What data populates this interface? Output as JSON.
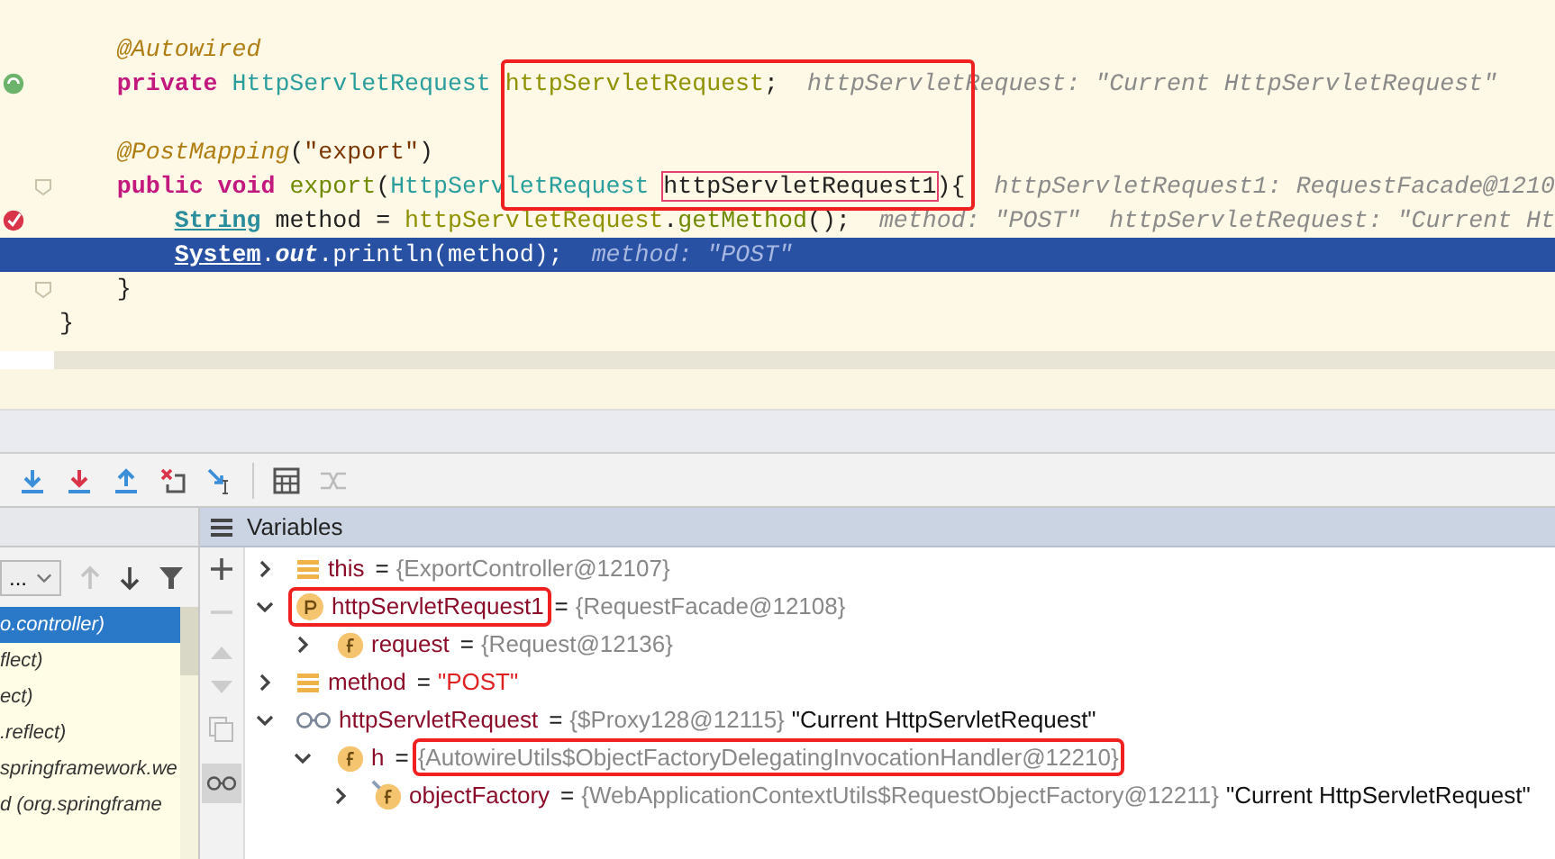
{
  "editor": {
    "lines": [
      {
        "kind": "code",
        "fold": false,
        "highlighted": false,
        "code": [
          {
            "kind": "annotation",
            "text": "    @Autowired"
          }
        ]
      },
      {
        "kind": "code",
        "gutter": {
          "kind": "bean"
        },
        "fold": false,
        "highlighted": false,
        "code": [
          {
            "kind": "keyword",
            "text": "    private "
          },
          {
            "kind": "type",
            "text": "HttpServletRequest "
          },
          {
            "kind": "field",
            "text": "httpServletRequest"
          },
          {
            "kind": "plain",
            "text": ";"
          }
        ],
        "hints": [
          "httpServletRequest: \"Current HttpServletRequest\""
        ]
      },
      {
        "kind": "blank"
      },
      {
        "kind": "code",
        "fold": false,
        "highlighted": false,
        "code": [
          {
            "kind": "annotation",
            "text": "    @PostMapping"
          },
          {
            "kind": "plain",
            "text": "("
          },
          {
            "kind": "string",
            "text": "\"export\""
          },
          {
            "kind": "plain",
            "text": ")"
          }
        ]
      },
      {
        "kind": "code",
        "fold": true,
        "highlighted": false,
        "code": [
          {
            "kind": "keyword",
            "text": "    public void "
          },
          {
            "kind": "method",
            "text": "export"
          },
          {
            "kind": "plain",
            "text": "("
          },
          {
            "kind": "type",
            "text": "HttpServletRequest "
          },
          {
            "kind": "param",
            "text": "httpServletRequest1",
            "boxed": true
          },
          {
            "kind": "plain",
            "text": "){"
          }
        ],
        "hints": [
          "httpServletRequest1: RequestFacade@1210"
        ]
      },
      {
        "kind": "code",
        "gutter": {
          "kind": "breakpoint"
        },
        "fold": false,
        "highlighted": false,
        "code": [
          {
            "kind": "class",
            "text": "        String"
          },
          {
            "kind": "plain",
            "text": " method = "
          },
          {
            "kind": "field",
            "text": "httpServletRequest"
          },
          {
            "kind": "plain",
            "text": "."
          },
          {
            "kind": "method",
            "text": "getMethod"
          },
          {
            "kind": "plain",
            "text": "();"
          }
        ],
        "hints": [
          "method: \"POST\"",
          "httpServletRequest: \"Current Ht"
        ]
      },
      {
        "kind": "code",
        "fold": false,
        "highlighted": true,
        "code": [
          {
            "kind": "class",
            "text": "        System"
          },
          {
            "kind": "plain",
            "text": "."
          },
          {
            "kind": "static",
            "text": "out"
          },
          {
            "kind": "plain",
            "text": ".println(method);"
          }
        ],
        "hints": [
          "method: \"POST\""
        ]
      },
      {
        "kind": "code",
        "fold": true,
        "highlighted": false,
        "code": [
          {
            "kind": "plain",
            "text": "    }"
          }
        ]
      },
      {
        "kind": "code",
        "fold": false,
        "highlighted": false,
        "code": [
          {
            "kind": "plain",
            "text": "}"
          }
        ]
      }
    ]
  },
  "frames": {
    "dropdown": "...",
    "items": [
      {
        "text": "o.controller)",
        "selected": true
      },
      {
        "text": "flect)",
        "selected": false
      },
      {
        "text": "ect)",
        "selected": false
      },
      {
        "text": ".reflect)",
        "selected": false
      },
      {
        "text": "springframework.we",
        "selected": false
      },
      {
        "text": "d (org.springframe",
        "selected": false
      }
    ]
  },
  "variables": {
    "title": "Variables",
    "rows": [
      {
        "kind": "fields",
        "name": "this",
        "operator": "=",
        "value": "{ExportController@12107}",
        "string_value": false,
        "expanded": false,
        "name_boxed": false,
        "value_boxed": false
      },
      {
        "kind": "param",
        "name": "httpServletRequest1",
        "operator": "=",
        "value": "{RequestFacade@12108}",
        "string_value": false,
        "expanded": true,
        "name_boxed": true,
        "value_boxed": false,
        "children": [
          {
            "kind": "field",
            "name": "request",
            "operator": "=",
            "value": "{Request@12136}",
            "string_value": false,
            "expanded": false,
            "name_boxed": false,
            "value_boxed": false
          }
        ]
      },
      {
        "kind": "fields",
        "name": "method",
        "operator": "=",
        "value": "\"POST\"",
        "string_value": true,
        "expanded": false,
        "name_boxed": false,
        "value_boxed": false
      },
      {
        "kind": "watch",
        "name": "httpServletRequest",
        "operator": "=",
        "value": "{$Proxy128@12115}",
        "string_value": false,
        "note": "\"Current HttpServletRequest\"",
        "expanded": true,
        "name_boxed": false,
        "value_boxed": false,
        "children": [
          {
            "kind": "field",
            "name": "h",
            "operator": "=",
            "value": "{AutowireUtils$ObjectFactoryDelegatingInvocationHandler@12210}",
            "string_value": false,
            "expanded": true,
            "name_boxed": false,
            "value_boxed": true,
            "children": [
              {
                "kind": "field-locked",
                "name": "objectFactory",
                "operator": "=",
                "value": "{WebApplicationContextUtils$RequestObjectFactory@12211}",
                "string_value": false,
                "note": "\"Current HttpServletRequest\"",
                "expanded": false,
                "name_boxed": false,
                "value_boxed": false
              }
            ]
          }
        ]
      }
    ]
  }
}
